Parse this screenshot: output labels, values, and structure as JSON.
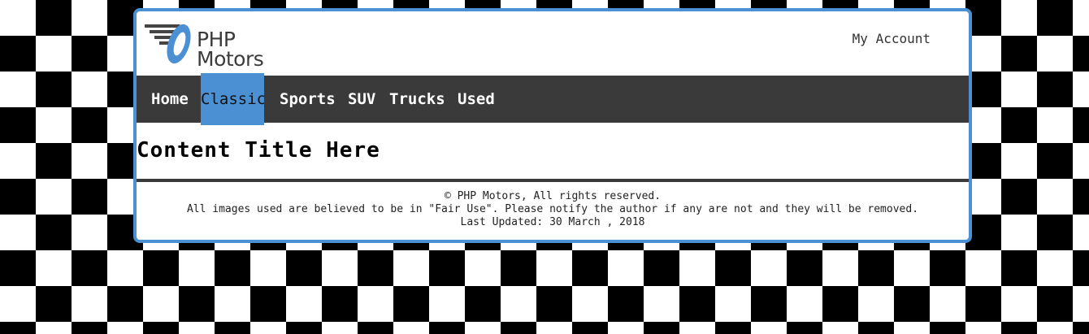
{
  "header": {
    "logo_text_line1": "PHP",
    "logo_text_line2": "Motors",
    "account_link": "My Account"
  },
  "nav": {
    "items": [
      {
        "label": "Home",
        "active": false
      },
      {
        "label": "Classic",
        "active": true
      },
      {
        "label": "Sports",
        "active": false
      },
      {
        "label": "SUV",
        "active": false
      },
      {
        "label": "Trucks",
        "active": false
      },
      {
        "label": "Used",
        "active": false
      }
    ]
  },
  "main": {
    "title": "Content Title Here"
  },
  "footer": {
    "copyright": "© PHP Motors, All rights reserved.",
    "fair_use": "All images used are believed to be in \"Fair Use\". Please notify the author if any are not and they will be removed.",
    "last_updated": "Last Updated: 30 March , 2018"
  },
  "colors": {
    "accent": "#4a90d2",
    "nav_bg": "#3a3a3a",
    "checker_dark": "#000000",
    "checker_light": "#ffffff"
  }
}
